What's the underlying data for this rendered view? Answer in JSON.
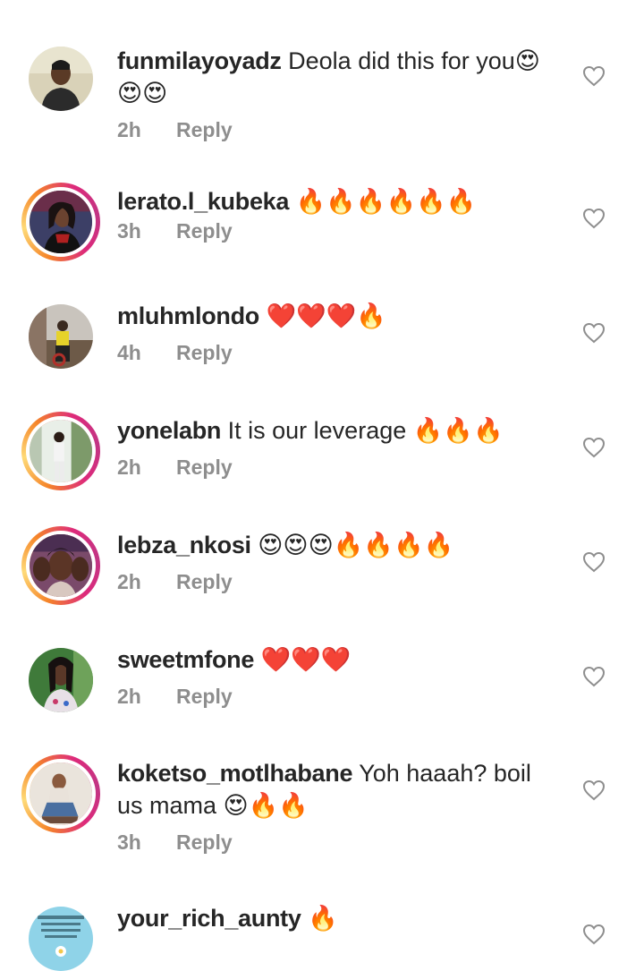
{
  "comments": [
    {
      "username": "funmilayoyadz",
      "line1": "Deola did this for you😍",
      "line2": "😍😍",
      "time": "2h",
      "reply": "Reply",
      "like_icon": "heart-outline-icon"
    },
    {
      "username": "lerato.l_kubeka",
      "line1": "🔥🔥🔥🔥🔥🔥",
      "line2": "",
      "time": "3h",
      "reply": "Reply",
      "like_icon": "heart-outline-icon"
    },
    {
      "username": "mluhmlondo",
      "line1": "❤️❤️❤️🔥",
      "line2": "",
      "time": "4h",
      "reply": "Reply",
      "like_icon": "heart-outline-icon"
    },
    {
      "username": "yonelabn",
      "line1": "It is our leverage 🔥🔥🔥",
      "line2": "",
      "time": "2h",
      "reply": "Reply",
      "like_icon": "heart-outline-icon"
    },
    {
      "username": "lebza_nkosi",
      "line1": "😍😍😍🔥🔥🔥🔥",
      "line2": "",
      "time": "2h",
      "reply": "Reply",
      "like_icon": "heart-outline-icon"
    },
    {
      "username": "sweetmfone",
      "line1": "❤️❤️❤️",
      "line2": "",
      "time": "2h",
      "reply": "Reply",
      "like_icon": "heart-outline-icon"
    },
    {
      "username": "koketso_motlhabane",
      "line1": "Yoh haaah? boil",
      "line2": "us mama 😍🔥🔥",
      "time": "3h",
      "reply": "Reply",
      "like_icon": "heart-outline-icon"
    },
    {
      "username": "your_rich_aunty",
      "line1": "🔥",
      "line2": "",
      "time": "",
      "reply": "",
      "like_icon": "heart-outline-icon"
    }
  ],
  "colors": {
    "text": "#262626",
    "meta": "#8e8e8e",
    "story_ring_start": "#f58529",
    "story_ring_end": "#dd2a7b"
  }
}
